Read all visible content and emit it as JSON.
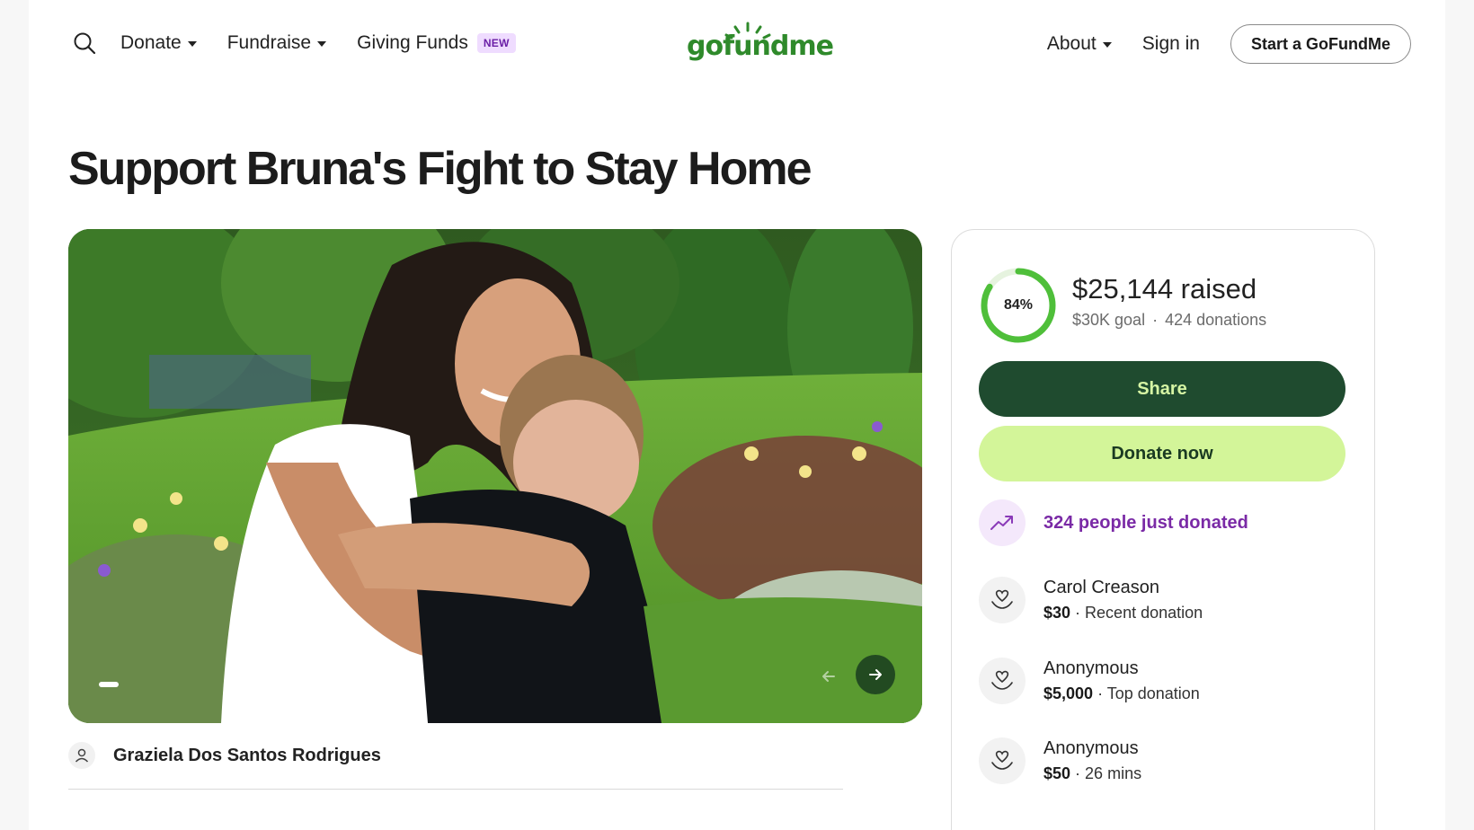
{
  "header": {
    "nav_left": [
      {
        "label": "Donate",
        "has_caret": true
      },
      {
        "label": "Fundraise",
        "has_caret": true
      },
      {
        "label": "Giving Funds",
        "badge": "NEW"
      }
    ],
    "logo_text": "gofundme",
    "nav_right": [
      {
        "label": "About",
        "has_caret": true
      },
      {
        "label": "Sign in"
      }
    ],
    "start_button": "Start a GoFundMe"
  },
  "campaign": {
    "title": "Support Bruna's Fight to Stay Home",
    "organizer": "Graziela Dos Santos Rodrigues"
  },
  "card": {
    "progress_percent": "84%",
    "progress_fraction": 0.84,
    "raised": "$25,144 raised",
    "goal": "$30K goal",
    "donations": "424 donations",
    "share_label": "Share",
    "donate_label": "Donate now",
    "trend_text": "324 people just donated",
    "donors": [
      {
        "name": "Carol Creason",
        "amount": "$30",
        "note": "Recent donation"
      },
      {
        "name": "Anonymous",
        "amount": "$5,000",
        "note": "Top donation"
      },
      {
        "name": "Anonymous",
        "amount": "$50",
        "note": "26 mins"
      }
    ]
  },
  "colors": {
    "brand_green": "#2f8a2b",
    "share_bg": "#1f4b2f",
    "donate_bg": "#d3f599",
    "trend_purple": "#7a2aa6",
    "ring_green": "#4fbf3a"
  },
  "icons": {
    "search": "search-icon",
    "caret": "caret-down-icon",
    "trend": "trending-up-icon",
    "donor": "heart-hand-icon",
    "organizer": "user-icon",
    "next": "arrow-right-icon",
    "prev": "arrow-left-icon"
  }
}
